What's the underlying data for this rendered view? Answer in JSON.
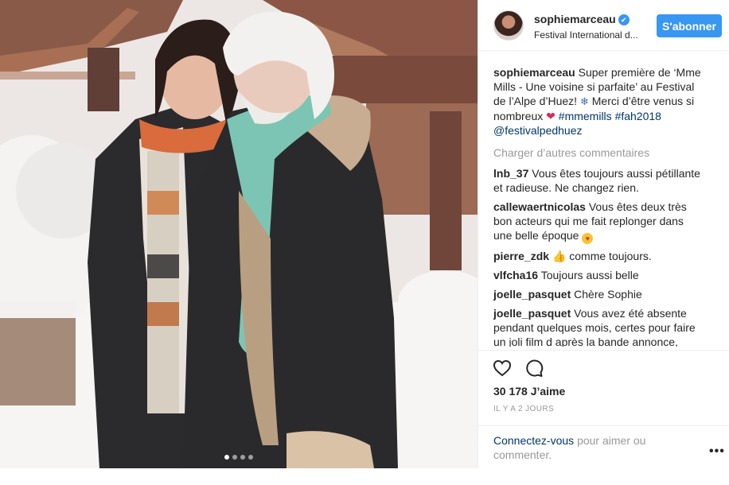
{
  "post": {
    "author": "sophiemarceau",
    "location": "Festival International d...",
    "follow_label": "S'abonner",
    "caption": {
      "user": "sophiemarceau",
      "text_1": "Super première de ‘Mme Mills - Une voisine si parfaite’ au Festival de l’Alpe d’Huez!",
      "text_2": "Merci d’être venus si nombreux",
      "hashtag_1": "#mmemills",
      "hashtag_2": "#fah2018",
      "mention": "@festivalpedhuez"
    },
    "load_more": "Charger d’autres commentaires",
    "comments": [
      {
        "user": "lnb_37",
        "text": "Vous êtes toujours aussi pétillante et radieuse. Ne changez rien."
      },
      {
        "user": "callewaertnicolas",
        "text": "Vous êtes deux très bon acteurs qui me fait replonger dans une belle époque",
        "emoji": "face-blowing-kiss"
      },
      {
        "user": "pierre_zdk",
        "text": "comme toujours.",
        "emoji": "thumbs-up"
      },
      {
        "user": "vlfcha16",
        "text": "Toujours aussi belle"
      },
      {
        "user": "joelle_pasquet",
        "text": "Chère Sophie"
      },
      {
        "user": "joelle_pasquet",
        "text": "Vous avez été absente pendant quelques mois, certes pour faire un joli film d après la bande annonce, mais"
      }
    ],
    "likes": "30 178 J’aime",
    "timestamp": "IL Y A 2 JOURS",
    "login_link": "Connectez-vous",
    "login_rest": "pour aimer ou commenter.",
    "more_label": "•••"
  },
  "carousel": {
    "count": 4,
    "active_index": 0
  },
  "icons": {
    "verified": "verified-badge-icon",
    "heart": "heart-icon",
    "comment": "comment-icon",
    "more": "more-options-icon"
  },
  "colors": {
    "accent": "#3897f0",
    "link": "#003569",
    "muted": "#999999",
    "text": "#262626",
    "border": "#efefef"
  }
}
